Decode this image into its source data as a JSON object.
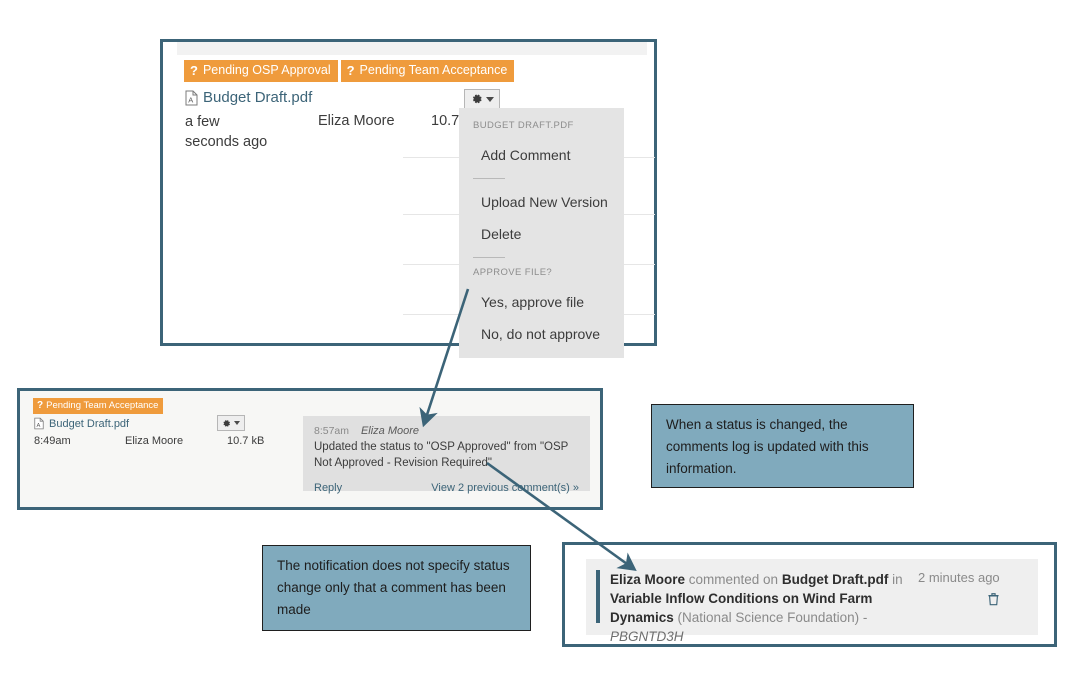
{
  "top_panel": {
    "badges": [
      {
        "icon": "question-mark-icon",
        "label": "Pending OSP Approval"
      },
      {
        "icon": "question-mark-icon",
        "label": "Pending Team Acceptance"
      }
    ],
    "file": {
      "icon": "pdf-file-icon",
      "name": "Budget Draft.pdf",
      "time": "a few seconds ago",
      "user": "Eliza Moore",
      "size": "10.7 kB"
    },
    "gear_button": {
      "icon": "gear-icon",
      "caret": "caret-down-icon"
    },
    "menu": {
      "header": "BUDGET DRAFT.PDF",
      "group_one": [
        "Add Comment"
      ],
      "group_two": [
        "Upload New Version",
        "Delete"
      ],
      "approve_header": "APPROVE FILE?",
      "group_three": [
        "Yes, approve file",
        "No, do not approve"
      ]
    }
  },
  "middle_panel": {
    "badge": {
      "icon": "question-mark-icon",
      "label": "Pending Team Acceptance"
    },
    "file": {
      "icon": "pdf-file-icon",
      "name": "Budget Draft.pdf",
      "time": "8:49am",
      "user": "Eliza Moore",
      "size": "10.7 kB"
    },
    "gear_button": {
      "icon": "gear-icon",
      "caret": "caret-down-icon"
    },
    "comment": {
      "time": "8:57am",
      "author": "Eliza Moore",
      "body": "Updated the status to \"OSP Approved\" from \"OSP Not Approved - Revision Required\"",
      "reply_label": "Reply",
      "view_previous_label": "View 2 previous comment(s) »"
    }
  },
  "notification_panel": {
    "author": "Eliza Moore",
    "verb": " commented on ",
    "file": "Budget Draft.pdf",
    "connector": " in ",
    "project": "Variable Inflow Conditions on Wind Farm Dynamics",
    "sponsor": " (National Science Foundation) - ",
    "code": "PBGNTD3H",
    "time": "2 minutes ago",
    "delete_icon": "trash-icon"
  },
  "callouts": [
    {
      "id": "status-change-note",
      "text": "When a status is changed, the comments log is updated with this information."
    },
    {
      "id": "notification-note",
      "text": "The notification does not specify status change only that a comment has been made"
    }
  ],
  "colors": {
    "panel_border": "#3c6478",
    "badge_orange": "#ef9b3c",
    "link_teal": "#3c6478",
    "callout_blue": "#80aabd",
    "menu_gray": "#e4e4e4",
    "comment_gray": "#e0e0e0",
    "notification_gray": "#efefef"
  }
}
